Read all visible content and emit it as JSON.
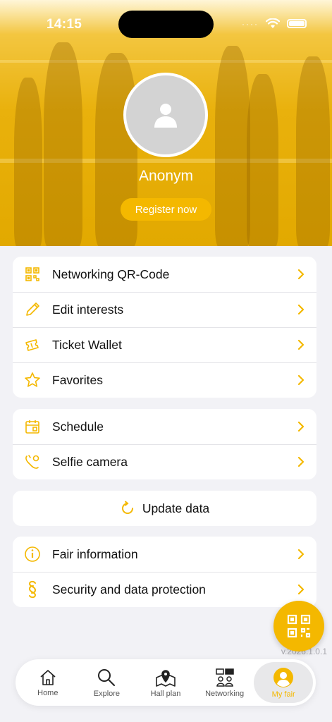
{
  "colors": {
    "accent": "#f4b800",
    "background": "#f2f2f6"
  },
  "status": {
    "time": "14:15"
  },
  "profile": {
    "name": "Anonym",
    "register_label": "Register now"
  },
  "menu_groups": [
    [
      {
        "label": "Networking QR-Code",
        "icon": "qr-code-icon"
      },
      {
        "label": "Edit interests",
        "icon": "pencil-icon"
      },
      {
        "label": "Ticket Wallet",
        "icon": "ticket-icon"
      },
      {
        "label": "Favorites",
        "icon": "star-icon"
      }
    ],
    [
      {
        "label": "Schedule",
        "icon": "calendar-icon"
      },
      {
        "label": "Selfie camera",
        "icon": "selfie-camera-icon"
      }
    ],
    [
      {
        "label": "Update data",
        "icon": "refresh-icon"
      }
    ],
    [
      {
        "label": "Fair information",
        "icon": "info-icon"
      },
      {
        "label": "Security and data protection",
        "icon": "paragraph-icon"
      }
    ]
  ],
  "version": "v.2026.1.0.1",
  "tabs": [
    {
      "label": "Home",
      "icon": "home-icon"
    },
    {
      "label": "Explore",
      "icon": "search-icon"
    },
    {
      "label": "Hall plan",
      "icon": "map-icon"
    },
    {
      "label": "Networking",
      "icon": "networking-icon"
    },
    {
      "label": "My fair",
      "icon": "user-icon",
      "active": true
    }
  ]
}
